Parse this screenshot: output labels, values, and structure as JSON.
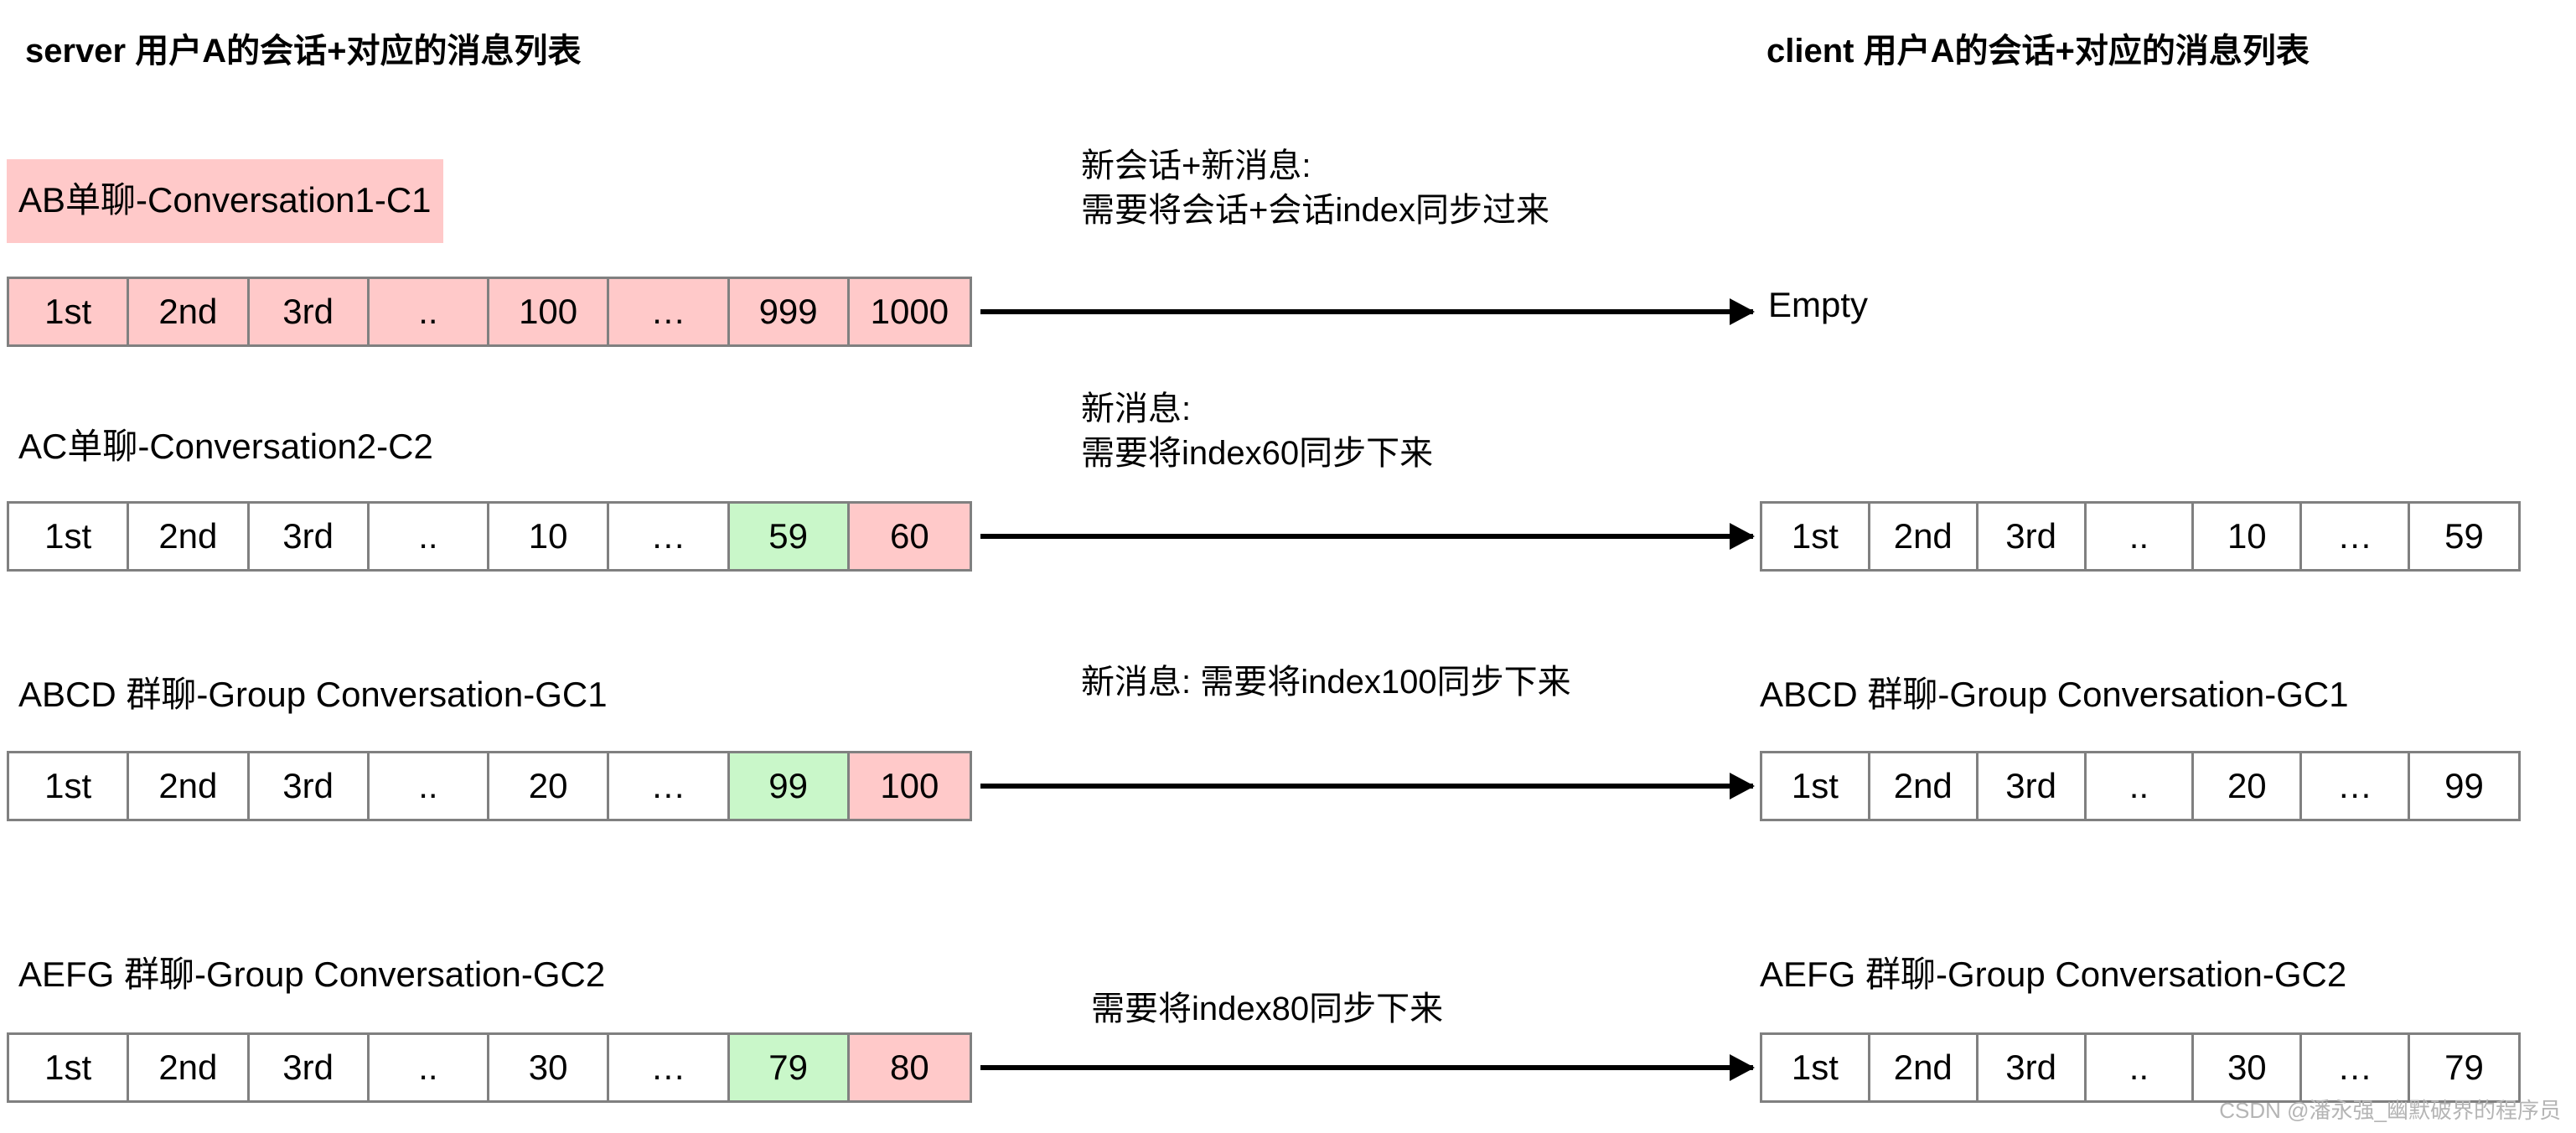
{
  "headers": {
    "server": "server 用户A的会话+对应的消息列表",
    "client": "client 用户A的会话+对应的消息列表"
  },
  "colors": {
    "pink": "#ffc9c9",
    "green": "#c9f7c9",
    "border": "#808080",
    "arrow": "#000000",
    "watermark": "#b5b5b5"
  },
  "rows": [
    {
      "server_label": "AB单聊-Conversation1-C1",
      "server_label_highlighted": true,
      "server_cells": [
        {
          "text": "1st",
          "fill": "pink"
        },
        {
          "text": "2nd",
          "fill": "pink"
        },
        {
          "text": "3rd",
          "fill": "pink"
        },
        {
          "text": "..",
          "fill": "pink"
        },
        {
          "text": "100",
          "fill": "pink"
        },
        {
          "text": "…",
          "fill": "pink"
        },
        {
          "text": "999",
          "fill": "pink"
        },
        {
          "text": "1000",
          "fill": "pink"
        }
      ],
      "annotation": [
        "新会话+新消息:",
        "需要将会话+会话index同步过来"
      ],
      "client_label": "",
      "client_empty_text": "Empty",
      "client_cells": []
    },
    {
      "server_label": "AC单聊-Conversation2-C2",
      "server_label_highlighted": false,
      "server_cells": [
        {
          "text": "1st",
          "fill": "none"
        },
        {
          "text": "2nd",
          "fill": "none"
        },
        {
          "text": "3rd",
          "fill": "none"
        },
        {
          "text": "..",
          "fill": "none"
        },
        {
          "text": "10",
          "fill": "none"
        },
        {
          "text": "…",
          "fill": "none"
        },
        {
          "text": "59",
          "fill": "green"
        },
        {
          "text": "60",
          "fill": "pink"
        }
      ],
      "annotation": [
        "新消息:",
        "需要将index60同步下来"
      ],
      "client_label": "",
      "client_empty_text": "",
      "client_cells": [
        {
          "text": "1st",
          "fill": "none"
        },
        {
          "text": "2nd",
          "fill": "none"
        },
        {
          "text": "3rd",
          "fill": "none"
        },
        {
          "text": "..",
          "fill": "none"
        },
        {
          "text": "10",
          "fill": "none"
        },
        {
          "text": "…",
          "fill": "none"
        },
        {
          "text": "59",
          "fill": "none"
        }
      ]
    },
    {
      "server_label": "ABCD 群聊-Group Conversation-GC1",
      "server_label_highlighted": false,
      "server_cells": [
        {
          "text": "1st",
          "fill": "none"
        },
        {
          "text": "2nd",
          "fill": "none"
        },
        {
          "text": "3rd",
          "fill": "none"
        },
        {
          "text": "..",
          "fill": "none"
        },
        {
          "text": "20",
          "fill": "none"
        },
        {
          "text": "…",
          "fill": "none"
        },
        {
          "text": "99",
          "fill": "green"
        },
        {
          "text": "100",
          "fill": "pink"
        }
      ],
      "annotation": [
        "新消息: 需要将index100同步下来"
      ],
      "client_label": "ABCD 群聊-Group Conversation-GC1",
      "client_empty_text": "",
      "client_cells": [
        {
          "text": "1st",
          "fill": "none"
        },
        {
          "text": "2nd",
          "fill": "none"
        },
        {
          "text": "3rd",
          "fill": "none"
        },
        {
          "text": "..",
          "fill": "none"
        },
        {
          "text": "20",
          "fill": "none"
        },
        {
          "text": "…",
          "fill": "none"
        },
        {
          "text": "99",
          "fill": "none"
        }
      ]
    },
    {
      "server_label": "AEFG 群聊-Group Conversation-GC2",
      "server_label_highlighted": false,
      "server_cells": [
        {
          "text": "1st",
          "fill": "none"
        },
        {
          "text": "2nd",
          "fill": "none"
        },
        {
          "text": "3rd",
          "fill": "none"
        },
        {
          "text": "..",
          "fill": "none"
        },
        {
          "text": "30",
          "fill": "none"
        },
        {
          "text": "…",
          "fill": "none"
        },
        {
          "text": "79",
          "fill": "green"
        },
        {
          "text": "80",
          "fill": "pink"
        }
      ],
      "annotation": [
        "需要将index80同步下来"
      ],
      "client_label": "AEFG 群聊-Group Conversation-GC2",
      "client_empty_text": "",
      "client_cells": [
        {
          "text": "1st",
          "fill": "none"
        },
        {
          "text": "2nd",
          "fill": "none"
        },
        {
          "text": "3rd",
          "fill": "none"
        },
        {
          "text": "..",
          "fill": "none"
        },
        {
          "text": "30",
          "fill": "none"
        },
        {
          "text": "…",
          "fill": "none"
        },
        {
          "text": "79",
          "fill": "none"
        }
      ]
    }
  ],
  "watermark": "CSDN @潘永强_幽默破界的程序员"
}
